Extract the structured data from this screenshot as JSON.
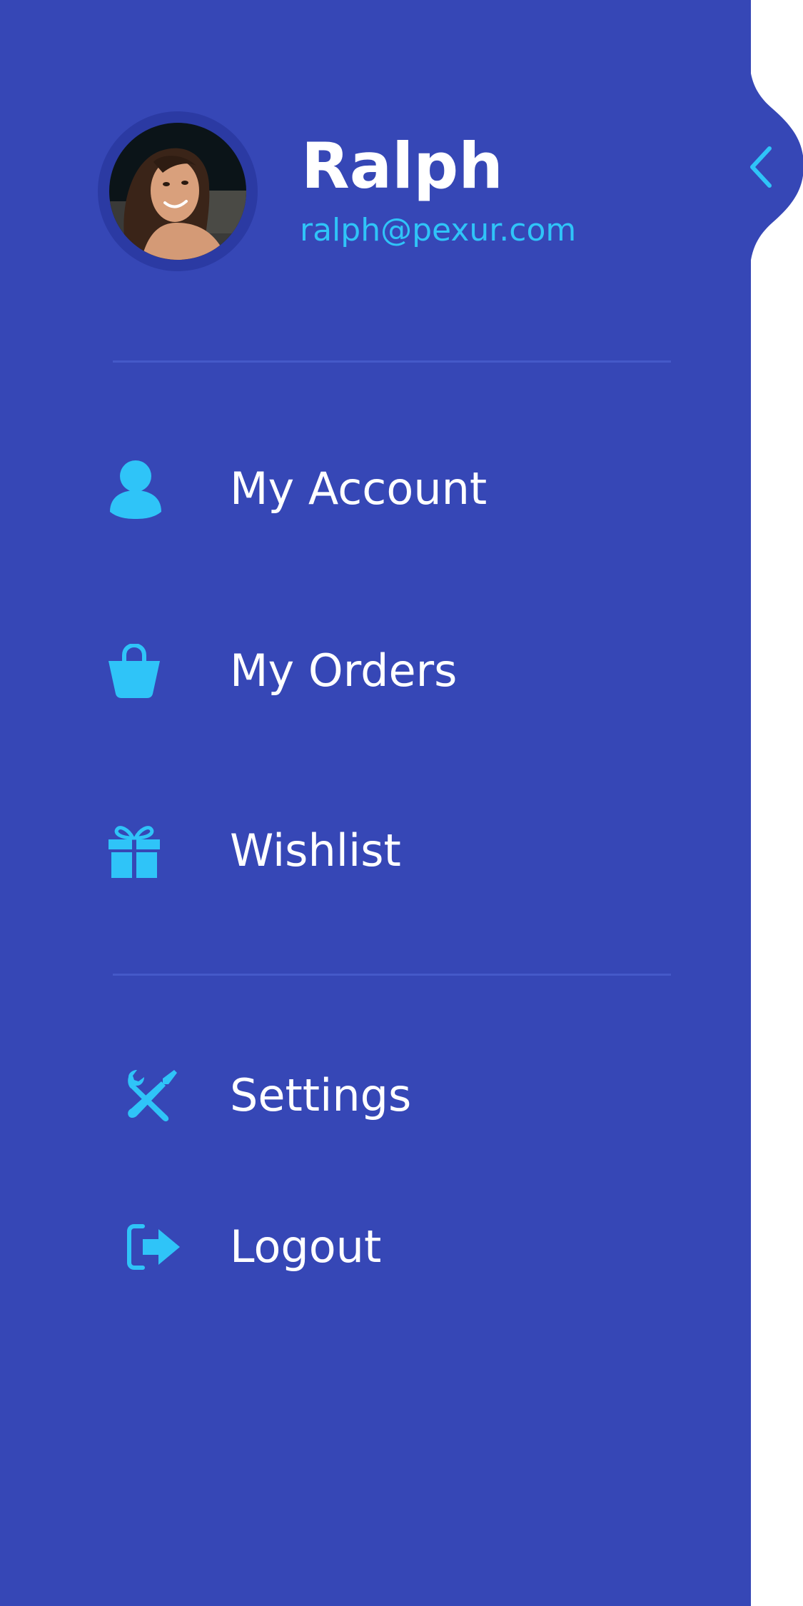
{
  "colors": {
    "drawer_bg": "#3647b6",
    "accent": "#2fc4f8",
    "text": "#ffffff",
    "divider": "#4559c8",
    "page_bg": "#ffffff"
  },
  "header": {
    "name": "Ralph",
    "email": "ralph@pexur.com",
    "avatar_icon": "user-photo"
  },
  "collapse": {
    "icon": "chevron-left-icon"
  },
  "menu": {
    "primary": [
      {
        "label": "My Account",
        "icon": "user-icon"
      },
      {
        "label": "My Orders",
        "icon": "shopping-bag-icon"
      },
      {
        "label": "Wishlist",
        "icon": "gift-icon"
      }
    ],
    "secondary": [
      {
        "label": "Settings",
        "icon": "tools-icon"
      },
      {
        "label": "Logout",
        "icon": "logout-icon"
      }
    ]
  }
}
